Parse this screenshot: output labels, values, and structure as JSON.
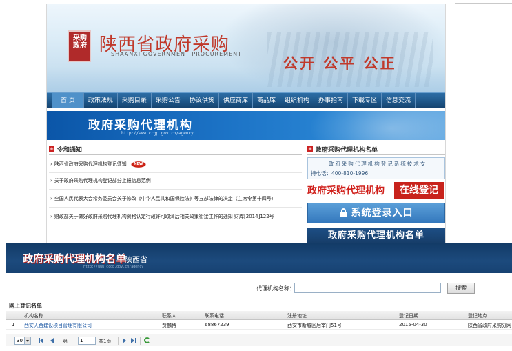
{
  "site": {
    "logo_text": "采购政府",
    "title": "陕西省政府采购",
    "subtitle": "SHAANXI GOVERNMENT PROCUREMENT",
    "slogan": "公开 公平 公正",
    "nav": [
      "首 页",
      "政策法规",
      "采购目录",
      "采购公告",
      "协议供货",
      "供应商库",
      "商品库",
      "组织机构",
      "办事指南",
      "下载专区",
      "信息交流"
    ],
    "section_title": "政府采购代理机构",
    "section_url": "http://www.ccgp.gov.cn/agency",
    "notices_heading": "令和通知",
    "notices": [
      "陕西省政府采购代理机构登记须知",
      "关于政府采购代理机构登记部分上报信息范例",
      "全国人民代表大会常务委员会关于修改《中华人民共和国保险法》等五部法律的决定（主席令第十四号）",
      "财政部关于做好政府采购代理机构资格认定行政许可取消后相关政策衔接工作的通知 财库[2014]122号"
    ],
    "new_badge": "NEW",
    "right_heading": "政府采购代理机构名单",
    "support_text": "政府采购代理机构登记系统技术支",
    "support_phone": "持电话：400-810-1996",
    "online_reg_a": "政府采购代理机构",
    "online_reg_b": "在线登记",
    "login_label": "系统登录入口",
    "list_label": "政府采购代理机构名单"
  },
  "registry": {
    "title": "政府采购代理机构名单",
    "province": "陕西省",
    "url": "http://www.ccgp.gov.cn/agency",
    "search_label": "代理机构名称：",
    "search_value": "",
    "search_button": "搜索",
    "grid_title": "网上登记名单",
    "columns": [
      "机构名称",
      "联系人",
      "联系电话",
      "注册地址",
      "登记日期",
      "登记地点"
    ],
    "rows": [
      {
        "index": "1",
        "name": "西安天合建设项目管理有限公司",
        "contact": "贾麟博",
        "phone": "68867239",
        "address": "西安市新城区后宰门51号",
        "date": "2015-04-30",
        "place": "陕西省政府采购分网"
      }
    ],
    "pager": {
      "page_size": "30",
      "page_prefix": "第",
      "page_value": "1",
      "page_total": "共1页"
    }
  }
}
